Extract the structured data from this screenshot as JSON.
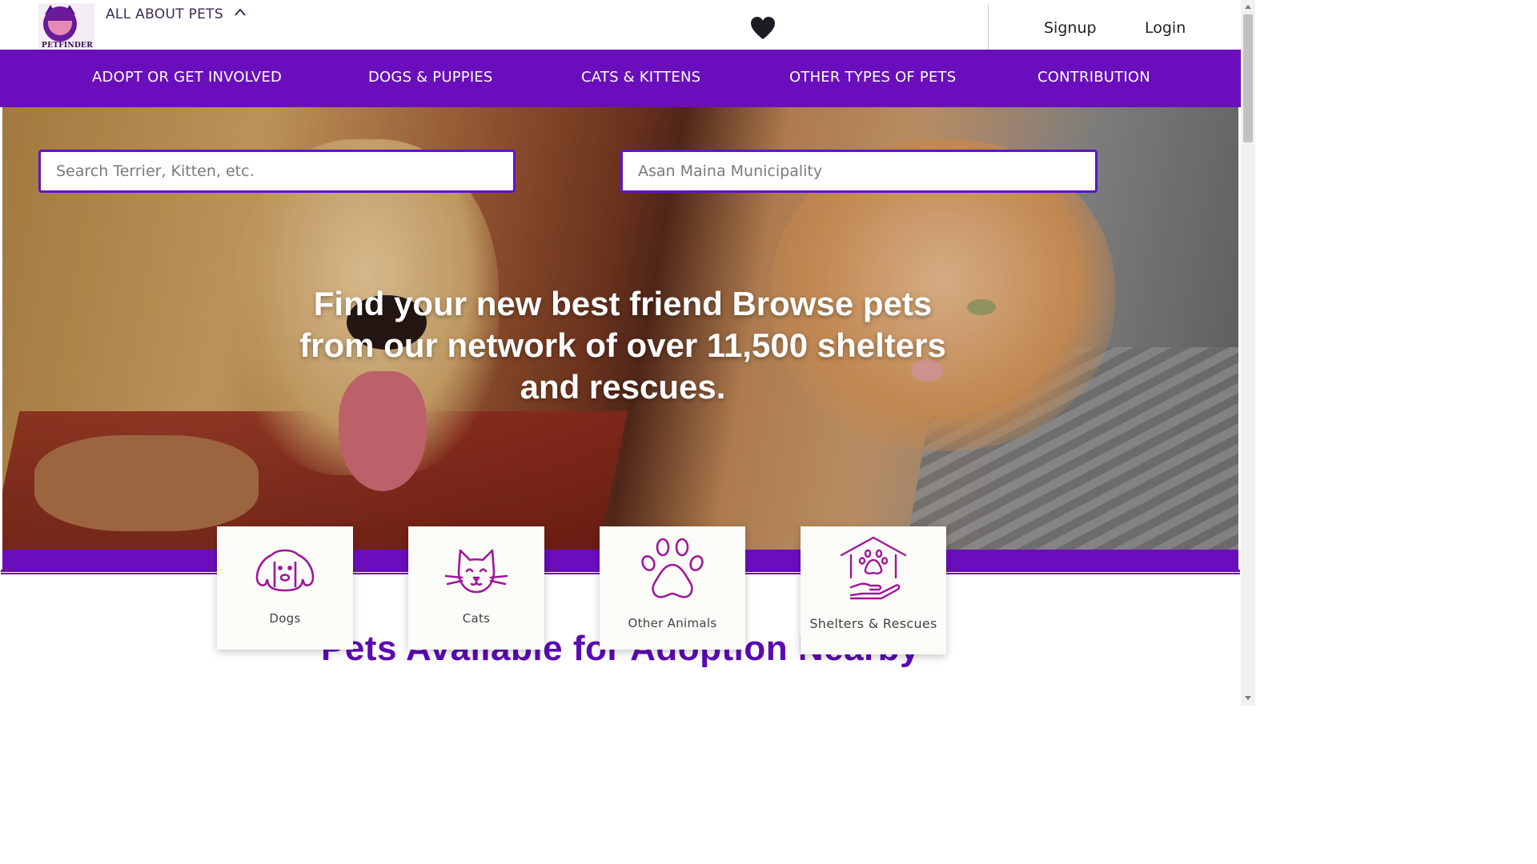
{
  "header": {
    "logo_text": "PETFINDER",
    "menu_label": "ALL ABOUT PETS",
    "signup_label": "Signup",
    "login_label": "Login"
  },
  "nav": {
    "items": [
      {
        "label": "ADOPT OR GET INVOLVED"
      },
      {
        "label": "DOGS & PUPPIES"
      },
      {
        "label": "CATS & KITTENS"
      },
      {
        "label": "OTHER TYPES OF PETS"
      },
      {
        "label": "CONTRIBUTION"
      }
    ]
  },
  "search": {
    "pet_placeholder": "Search Terrier, Kitten, etc.",
    "location_value": "Asan Maina Municipality"
  },
  "hero": {
    "headline": "Find your new best friend Browse pets from our network of over 11,500 shelters and rescues."
  },
  "categories": [
    {
      "label": "Dogs",
      "icon": "dog-icon"
    },
    {
      "label": "Cats",
      "icon": "cat-icon"
    },
    {
      "label": "Other Animals",
      "icon": "paw-icon"
    },
    {
      "label": "Shelters & Rescues",
      "icon": "shelter-icon"
    }
  ],
  "section": {
    "title": "Pets Available for Adoption Nearby"
  },
  "colors": {
    "brand_purple": "#6a0ebd",
    "icon_magenta": "#a0169b",
    "title_purple": "#5b09b3"
  }
}
